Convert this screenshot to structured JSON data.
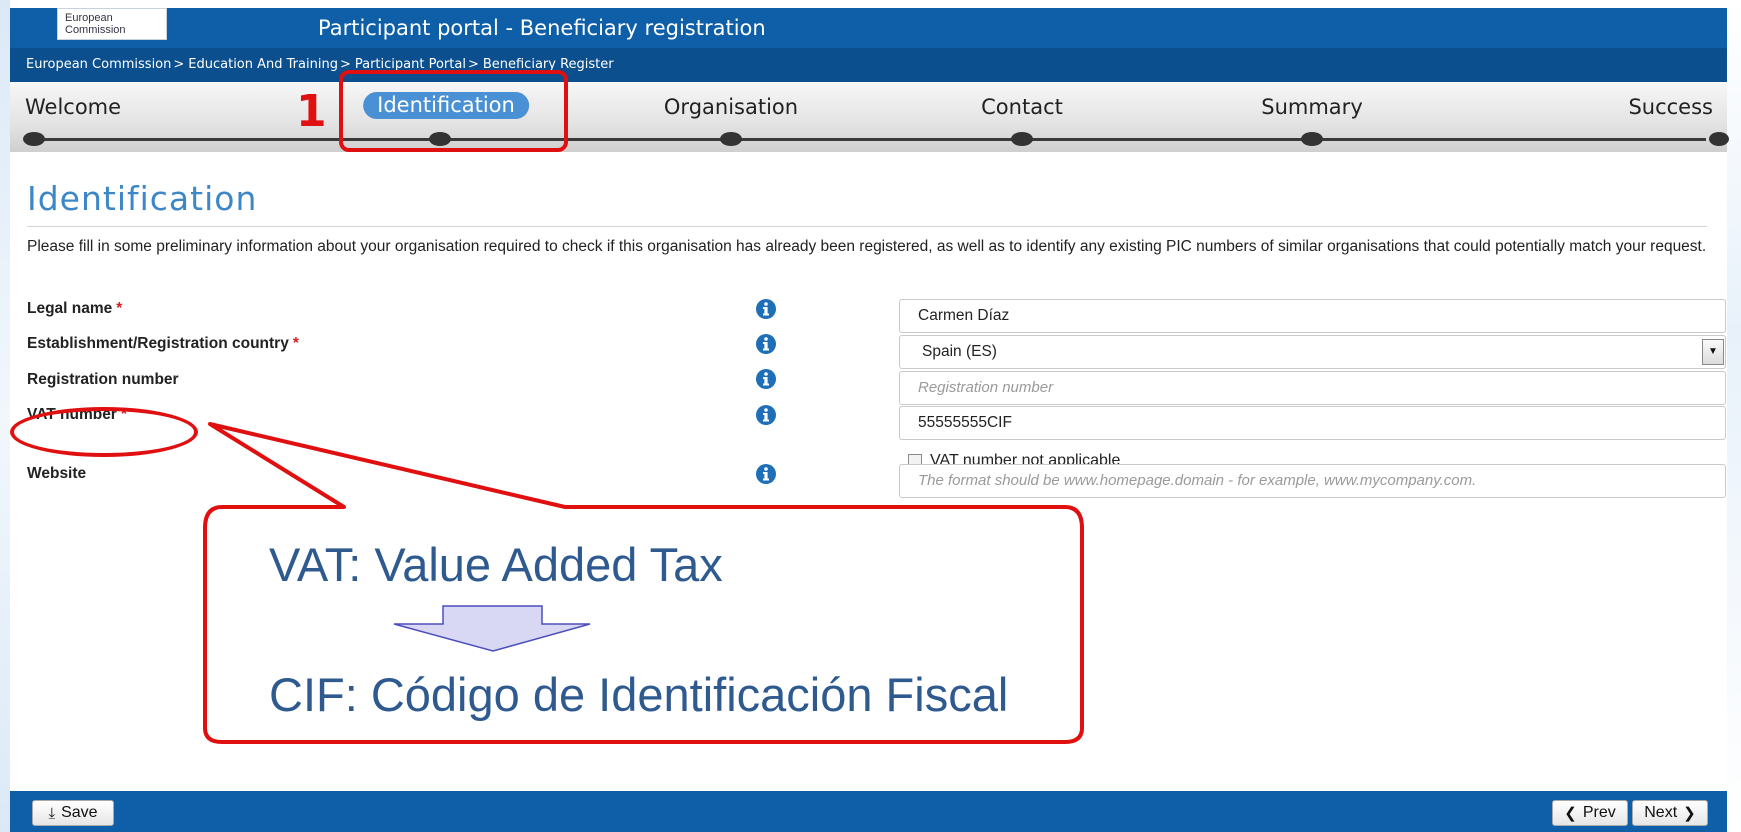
{
  "header": {
    "logo_line1": "European",
    "logo_line2": "Commission",
    "title": "Participant portal - Beneficiary registration"
  },
  "breadcrumb": [
    "European Commission",
    "Education And Training",
    "Participant Portal",
    "Beneficiary Register"
  ],
  "breadcrumb_separator": ">",
  "wizard": {
    "steps": [
      "Welcome",
      "Identification",
      "Organisation",
      "Contact",
      "Summary",
      "Success"
    ],
    "active_step": "Identification",
    "annotation_number": "1"
  },
  "page": {
    "title": "Identification",
    "intro": "Please fill in some preliminary information about your organisation required to check if this organisation has already been registered, as well as to identify any existing PIC numbers of similar organisations that could potentially match your request."
  },
  "form": {
    "required_marker": "*",
    "legal_name": {
      "label": "Legal name",
      "value": "Carmen Díaz"
    },
    "country": {
      "label": "Establishment/Registration country",
      "value": "Spain (ES)"
    },
    "registration_number": {
      "label": "Registration number",
      "placeholder": "Registration number"
    },
    "vat_number": {
      "label": "VAT number",
      "value": "55555555CIF"
    },
    "vat_not_applicable": {
      "label": "VAT number not applicable"
    },
    "website": {
      "label": "Website",
      "placeholder": "The format should be www.homepage.domain - for example, www.mycompany.com."
    }
  },
  "callout": {
    "line1": "VAT: Value Added Tax",
    "line2": "CIF: Código de Identificación Fiscal"
  },
  "footer": {
    "save_label": "Save",
    "prev_label": "Prev",
    "next_label": "Next"
  },
  "colors": {
    "header_blue": "#0e5fa8",
    "breadcrumb_blue": "#0b4f8e",
    "active_step": "#4a90d4",
    "title_blue": "#3d87c8",
    "annotation_red": "#e11010",
    "callout_text": "#2e5a8f",
    "arrow_fill": "#d8d8f4",
    "arrow_stroke": "#4d4dbd"
  },
  "icons": {
    "info": "info-circle-icon",
    "dropdown": "chevron-down-icon",
    "save": "download-icon",
    "prev": "chevron-left-icon",
    "next": "chevron-right-icon"
  }
}
